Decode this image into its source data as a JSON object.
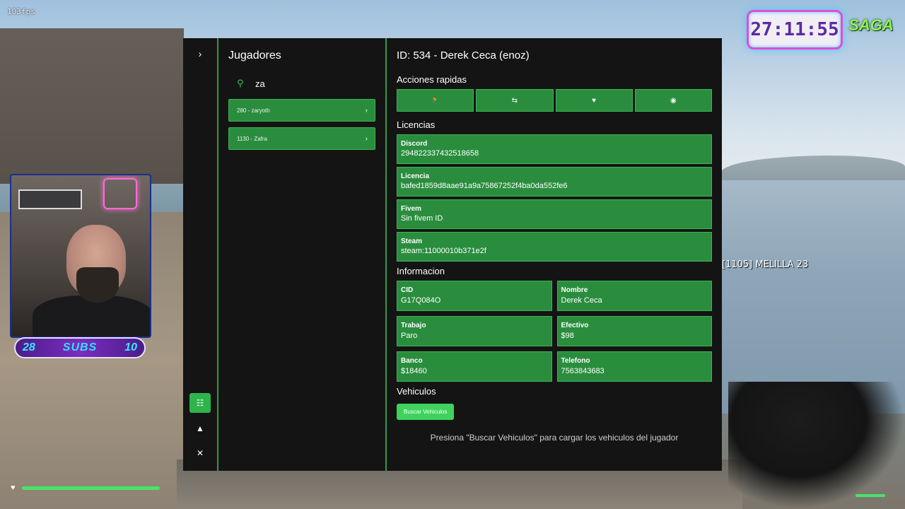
{
  "hud": {
    "fps": "103fps",
    "timer": "27:11:55",
    "logo": "SAGA",
    "player_tag": "[1105] MELILLA 23",
    "subs": {
      "left": "28",
      "label": "SUBS",
      "right": "10"
    }
  },
  "rail": {
    "expand_icon": "chevron-right-icon",
    "buttons": [
      {
        "icon": "players-icon",
        "active": true
      },
      {
        "icon": "warning-icon",
        "active": false
      },
      {
        "icon": "tools-icon",
        "active": false
      }
    ]
  },
  "players": {
    "title": "Jugadores",
    "search_value": "za",
    "items": [
      {
        "label": "280 - zaryoth"
      },
      {
        "label": "1130 - Zafra"
      }
    ]
  },
  "detail": {
    "header": "ID: 534 - Derek Ceca (enoz)",
    "quick_actions_title": "Acciones rapidas",
    "quick_actions": [
      {
        "icon": "goto-player-icon"
      },
      {
        "icon": "bring-player-icon"
      },
      {
        "icon": "heal-icon"
      },
      {
        "icon": "spectate-icon"
      }
    ],
    "licenses_title": "Licencias",
    "licenses": [
      {
        "key": "Discord",
        "value": "294822337432518658"
      },
      {
        "key": "Licencia",
        "value": "bafed1859d8aae91a9a75867252f4ba0da552fe6"
      },
      {
        "key": "Fivem",
        "value": "Sin fivem ID"
      },
      {
        "key": "Steam",
        "value": "steam:11000010b371e2f"
      }
    ],
    "info_title": "Informacion",
    "info": [
      {
        "key": "CID",
        "value": "G17Q084O"
      },
      {
        "key": "Nombre",
        "value": "Derek Ceca"
      },
      {
        "key": "Trabajo",
        "value": "Paro"
      },
      {
        "key": "Efectivo",
        "value": "$98"
      },
      {
        "key": "Banco",
        "value": "$18460"
      },
      {
        "key": "Telefono",
        "value": "7563843683"
      }
    ],
    "vehicles_title": "Vehiculos",
    "vehicles_button": "Buscar Vehiculos",
    "vehicles_hint": "Presiona \"Buscar Vehiculos\" para cargar los vehiculos del jugador"
  },
  "colors": {
    "accent": "#2fb34b",
    "card": "#2a8d3e",
    "panel": "#141414"
  }
}
